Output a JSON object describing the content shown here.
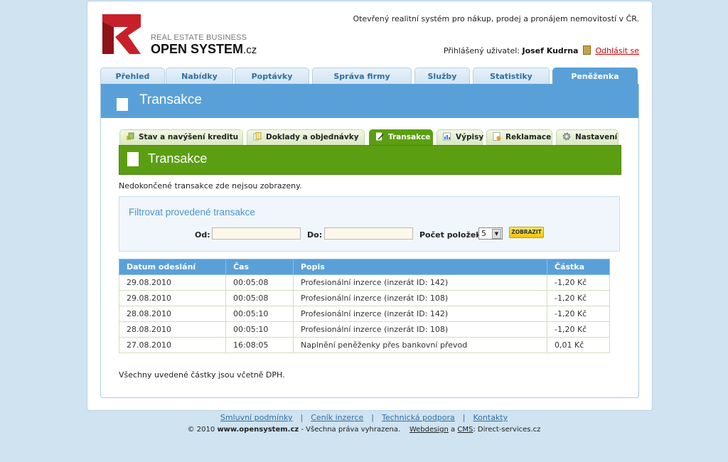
{
  "brand": {
    "small_text": "REAL ESTATE BUSINESS",
    "name": "OPEN SYSTEM",
    "suffix": ".cz",
    "color": "#c8202a"
  },
  "header": {
    "tagline": "Otevřený realitní systém pro nákup, prodej a pronájem nemovitostí v ČR.",
    "user_label": "Přihlášený uživatel:",
    "user_name": "Josef Kudrna",
    "logout": "Odhlásit se"
  },
  "main_tabs": [
    {
      "label": "Přehled"
    },
    {
      "label": "Nabídky"
    },
    {
      "label": "Poptávky"
    },
    {
      "label": "Správa firmy"
    },
    {
      "label": "Služby"
    },
    {
      "label": "Statistiky"
    },
    {
      "label": "Peněženka",
      "active": true
    }
  ],
  "section": {
    "title": "Transakce"
  },
  "sub_tabs": [
    {
      "label": "Stav a navýšení kreditu",
      "icon": "coins-icon"
    },
    {
      "label": "Doklady a objednávky",
      "icon": "documents-icon"
    },
    {
      "label": "Transakce",
      "icon": "document-edit-icon",
      "active": true
    },
    {
      "label": "Výpisy",
      "icon": "chart-icon"
    },
    {
      "label": "Reklamace",
      "icon": "complaint-icon"
    },
    {
      "label": "Nastavení",
      "icon": "gear-icon"
    }
  ],
  "panel": {
    "title": "Transakce",
    "note": "Nedokončené transakce zde nejsou zobrazeny.",
    "footnote": "Všechny uvedené částky jsou včetně DPH."
  },
  "filter": {
    "title": "Filtrovat provedené transakce",
    "from_label": "Od:",
    "to_label": "Do:",
    "from_value": "",
    "to_value": "",
    "count_label": "Počet položek:",
    "count_value": "5",
    "submit": "ZOBRAZIT"
  },
  "table": {
    "headers": [
      "Datum odeslání",
      "Čas",
      "Popis",
      "Částka"
    ],
    "rows": [
      [
        "29.08.2010",
        "00:05:08",
        "Profesionální inzerce (inzerát ID: 142)",
        "-1,20 Kč"
      ],
      [
        "29.08.2010",
        "00:05:08",
        "Profesionální inzerce (inzerát ID: 108)",
        "-1,20 Kč"
      ],
      [
        "28.08.2010",
        "00:05:10",
        "Profesionální inzerce (inzerát ID: 142)",
        "-1,20 Kč"
      ],
      [
        "28.08.2010",
        "00:05:10",
        "Profesionální inzerce (inzerát ID: 108)",
        "-1,20 Kč"
      ],
      [
        "27.08.2010",
        "16:08:05",
        "Naplnění peněženky přes bankovní převod",
        "0,01 Kč"
      ]
    ]
  },
  "footer": {
    "links": [
      "Smluvní podmínky",
      "Ceník inzerce",
      "Technická podpora",
      "Kontakty"
    ],
    "separator": "|",
    "copyright_prefix": "© 2010",
    "site": "www.opensystem.cz",
    "rights": "- Všechna práva vyhrazena.",
    "webdesign": "Webdesign",
    "and": "a",
    "cms": "CMS",
    "by": ": Direct-services.cz"
  },
  "colors": {
    "blue_accent": "#5aa0d8",
    "green_accent": "#5c9e12",
    "logout_red": "#cc0000"
  }
}
